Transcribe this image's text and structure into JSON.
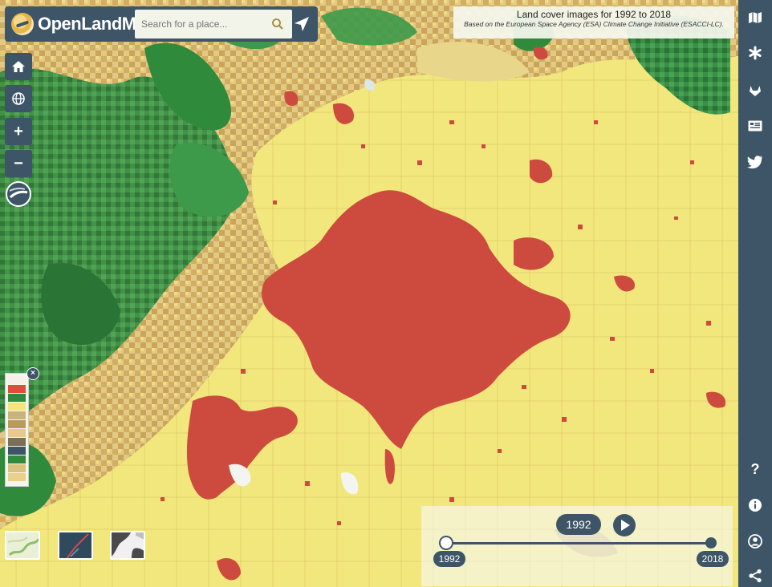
{
  "brand": {
    "name": "OpenLandMap"
  },
  "search": {
    "placeholder": "Search for a place..."
  },
  "map_controls": {
    "zoom_in": "+",
    "zoom_out": "−"
  },
  "title_panel": {
    "title": "Land cover images for 1992 to 2018",
    "subtitle": "Based on the European Space Agency (ESA) Climate Change Initiative (ESACCI-LC)."
  },
  "timeline": {
    "current_year": "1992",
    "start_year": "1992",
    "end_year": "2018",
    "progress": 0
  },
  "sidebar": {
    "help": "?",
    "info": "i"
  },
  "legend": {
    "colors": [
      "#f5f0e8",
      "#d94f3a",
      "#2f8a3c",
      "#f4e47a",
      "#c9b37b",
      "#b99b59",
      "#e8c88c",
      "#7a6f55",
      "#3d5566",
      "#2f8a3c",
      "#d9c27c",
      "#ead08a"
    ]
  },
  "palette": {
    "urban": "#cc4b3e",
    "cropland": "#f1e67a",
    "forest": "#2f8a3c",
    "mosaic": "#d4b56c",
    "ui_dark": "#3d5566"
  }
}
